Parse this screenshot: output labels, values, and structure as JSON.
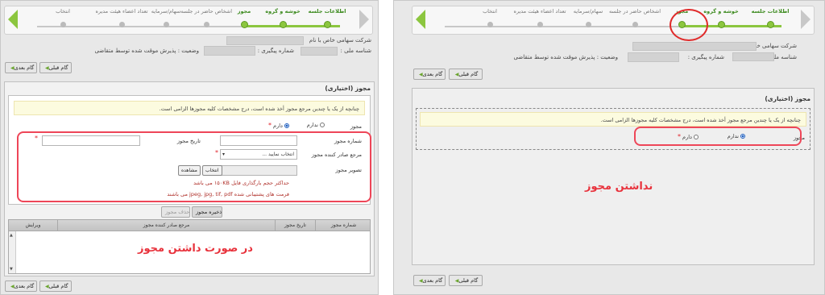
{
  "wizard_steps": [
    {
      "label": "اطلاعات جلسه",
      "state": "done"
    },
    {
      "label": "خوشه و گروه",
      "state": "done"
    },
    {
      "label": "مجوز",
      "state": "current"
    },
    {
      "label": "اشخاص حاضر در جلسه",
      "state": "todo"
    },
    {
      "label": "سهام/سرمایه",
      "state": "todo"
    },
    {
      "label": "تعداد اعضاء هیئت مدیره",
      "state": "todo"
    },
    {
      "label": "انتخاب",
      "state": "todo"
    }
  ],
  "company": {
    "type": "شرکت سهامی خاص",
    "name_suffix": "با نام",
    "national_id_label": "شناسه ملی :",
    "tracking_label": "شماره پیگیری :",
    "status": "وضعیت : پذیرش موقت شده توسط متقاضی"
  },
  "buttons": {
    "next": "گام بعدی",
    "previous": "گام قبلی",
    "save_license": "ذخیره مجوز",
    "delete_license": "حذف مجوز",
    "choose": "انتخاب",
    "view": "مشاهده"
  },
  "license_section": {
    "title": "مجوز (اختیاری)",
    "notice": "چنانچه از یک یا چندین مرجع مجوز أخذ شده است، درج مشخصات کلیه مجوزها الزامی است.",
    "has_license_label": "مجوز",
    "option_has": "دارم",
    "option_has_not": "ندارم",
    "license_number_label": "شماره مجوز",
    "license_date_label": "تاریخ مجوز",
    "issuer_label": "مرجع صادر کننده مجوز",
    "issuer_placeholder": "انتخاب نمایید ...",
    "image_label": "تصویر مجوز",
    "max_size_note": "حداکثر حجم بارگذاری فایل ۱۵۰KB می باشد",
    "formats_note": "فرمت های پشتیبانی شده jpeg, jpg, tif, pdf می باشند"
  },
  "table": {
    "columns": [
      "شماره مجوز",
      "تاریخ مجوز",
      "مرجع صادر کننده مجوز",
      "ویرایش"
    ]
  },
  "overlays": {
    "with_license": "در صورت داشتن مجوز",
    "without_license": "نداشتن مجوز"
  },
  "colors": {
    "accent_green": "#8cc63f",
    "annotation_red": "#ee4658",
    "notice_bg": "#fcfbdf"
  }
}
